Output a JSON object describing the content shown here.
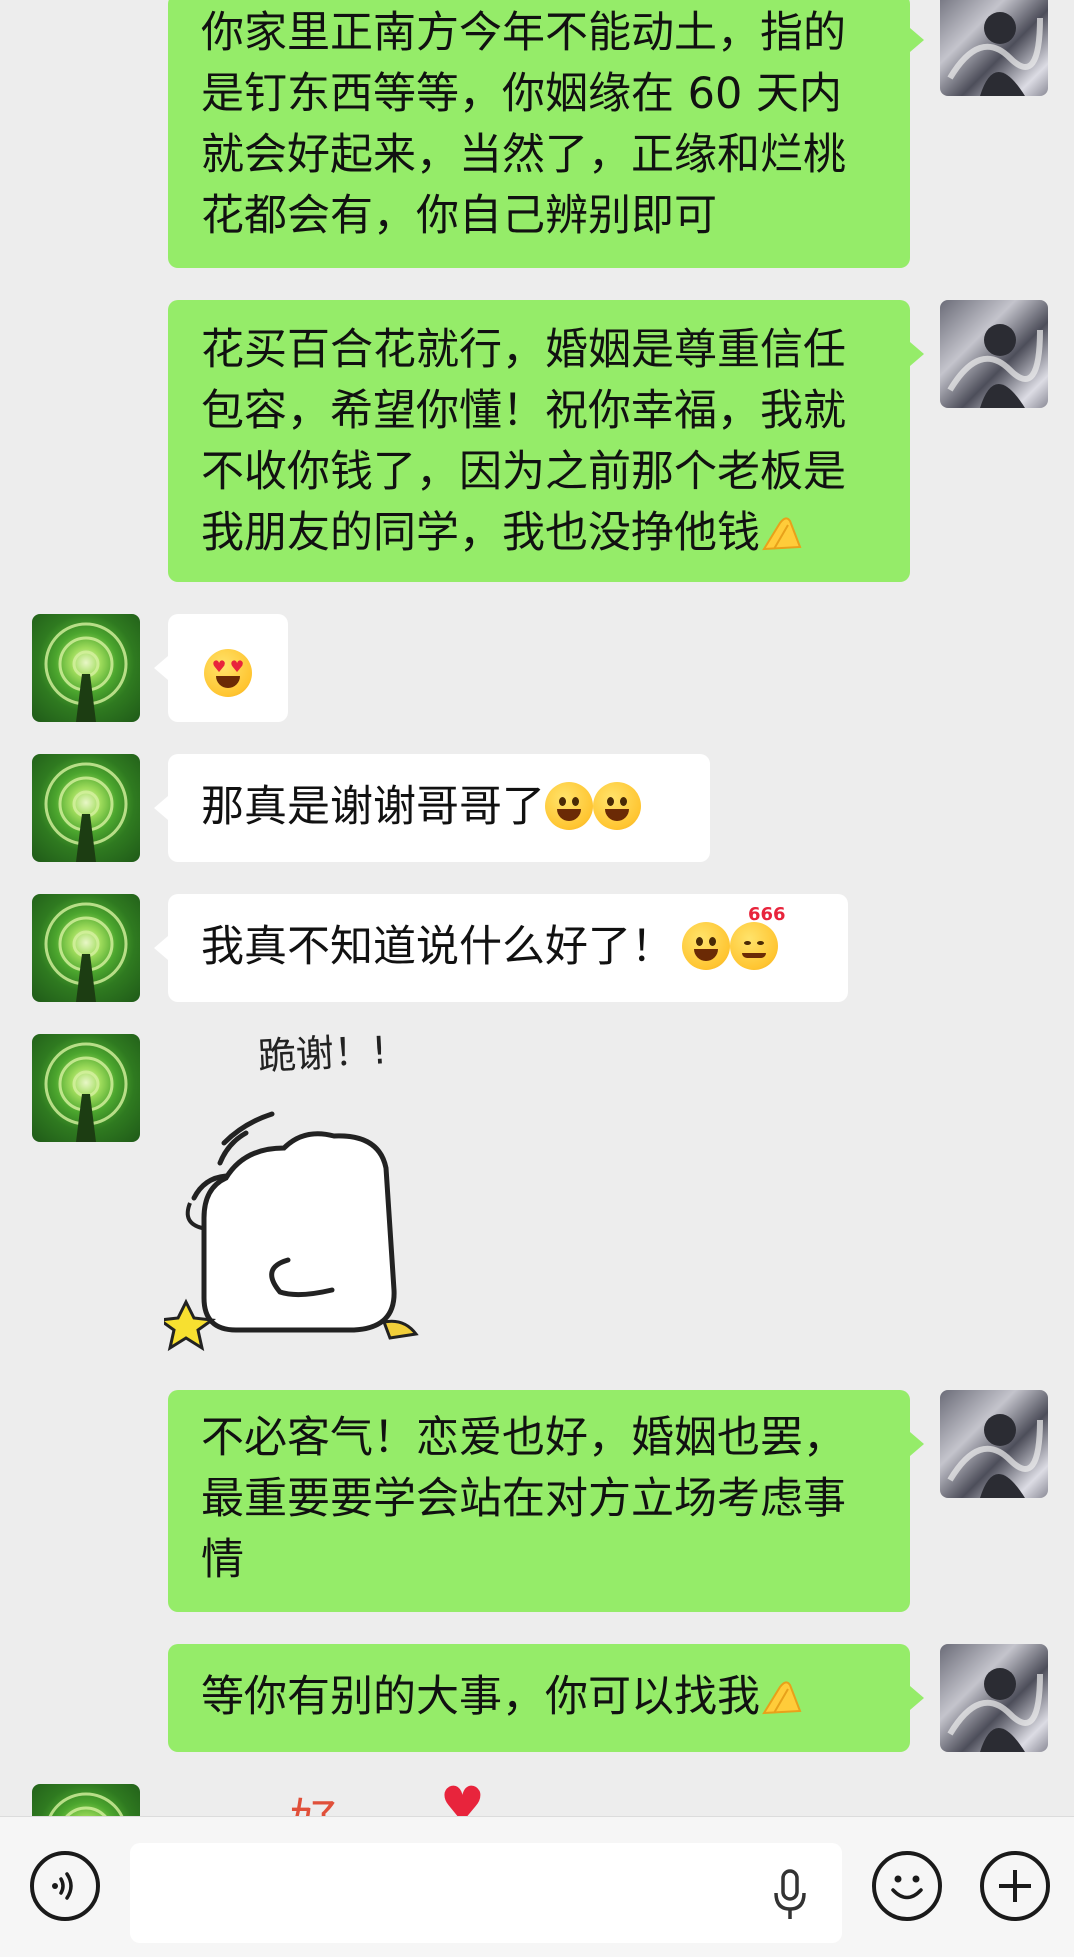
{
  "messages": [
    {
      "side": "right",
      "lines": [
        "你家里正南方今年不能动土，指的",
        "是钉东西等等，你姻缘在 60 天内",
        "就会好起来，当然了，正缘和烂桃",
        "花都会有，你自己辨别即可"
      ]
    },
    {
      "side": "right",
      "lines": [
        "花买百合花就行，婚姻是尊重信任",
        "包容，希望你懂！祝你幸福，我就",
        "不收你钱了，因为之前那个老板是",
        "我朋友的同学，我也没挣他钱"
      ]
    },
    {
      "side": "left",
      "emoji_only": true,
      "emoji": "heart-eyes-emoji"
    },
    {
      "side": "left",
      "text": "那真是谢谢哥哥了"
    },
    {
      "side": "left",
      "text": "我真不知道说什么好了！"
    },
    {
      "side": "left",
      "sticker": true,
      "sticker_text": "跪谢！!"
    },
    {
      "side": "right",
      "lines": [
        "不必客气！恋爱也好，婚姻也罢，",
        "最重要要学会站在对方立场考虑事",
        "情"
      ]
    },
    {
      "side": "right",
      "text": "等你有别的大事，你可以找我"
    },
    {
      "side": "left",
      "sticker_partial_text": "好"
    }
  ],
  "emoji_badge": "666",
  "input_bar": {
    "placeholder": "",
    "icons": [
      "voice-icon",
      "microphone-icon",
      "emoji-icon",
      "plus-icon"
    ]
  },
  "colors": {
    "background": "#ededed",
    "sent_bubble": "#95ec69",
    "received_bubble": "#ffffff",
    "input_bar": "#f6f6f6"
  }
}
